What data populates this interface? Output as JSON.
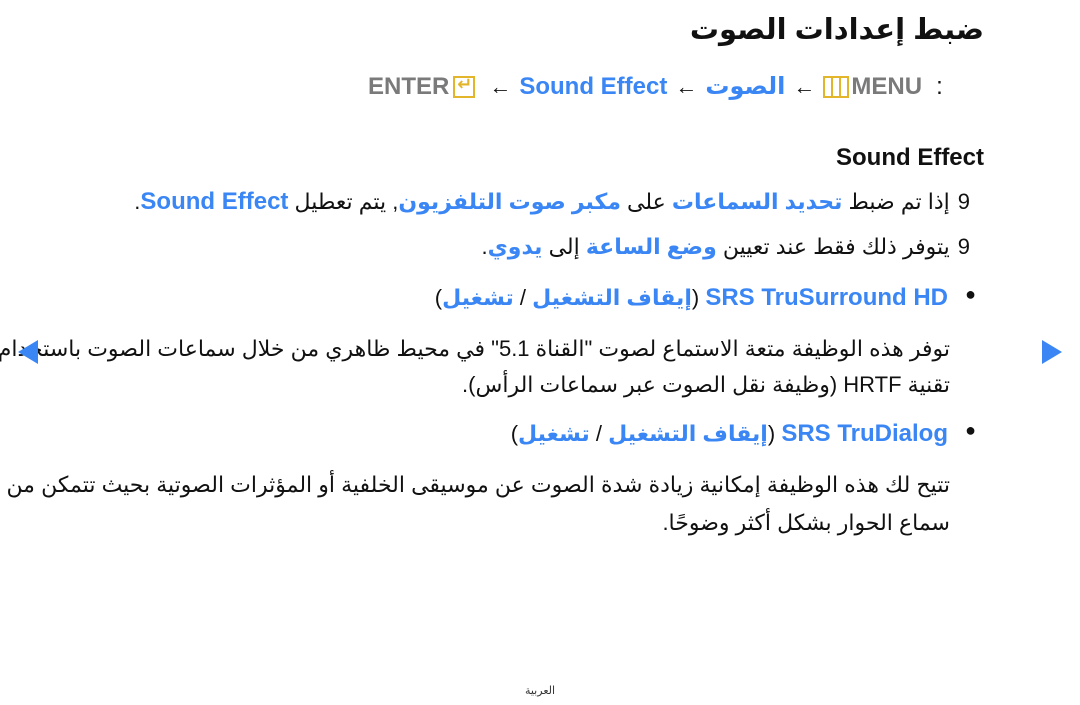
{
  "page": {
    "title": "ضبط إعدادات الصوت",
    "menu_path": {
      "enter_label": "ENTER",
      "enter_icon": "enter-icon",
      "arrow": "←",
      "sound_effect": "Sound Effect",
      "sound": "الصوت",
      "menu_icon": "menu-icon",
      "menu_label": "MENU",
      "colon": ":"
    },
    "section_heading": "Sound Effect",
    "notes": [
      {
        "marker": "9",
        "parts": [
          {
            "text": "إذا تم ضبط ",
            "style": "normal"
          },
          {
            "text": "تحديد السماعات",
            "style": "blue"
          },
          {
            "text": " على ",
            "style": "normal"
          },
          {
            "text": "مكبر صوت التلفزيون",
            "style": "blue"
          },
          {
            "text": ", يتم تعطيل ",
            "style": "normal"
          },
          {
            "text": "Sound Effect",
            "style": "bluebig"
          },
          {
            "text": ".",
            "style": "normal"
          }
        ]
      },
      {
        "marker": "9",
        "parts": [
          {
            "text": "يتوفر ذلك فقط عند تعيين ",
            "style": "normal"
          },
          {
            "text": "وضع الساعة",
            "style": "blue"
          },
          {
            "text": " إلى ",
            "style": "normal"
          },
          {
            "text": "يدوي",
            "style": "blue"
          },
          {
            "text": ".",
            "style": "normal"
          }
        ]
      }
    ],
    "options": [
      {
        "name": "SRS TruSurround HD",
        "values": "(إيقاف التشغيل / تشغيل)",
        "off": "إيقاف التشغيل",
        "on": "تشغيل",
        "description_lines": [
          "توفر هذه الوظيفة متعة الاستماع لصوت \"القناة 5.1\" في محيط ظاهري من خلال سماعات الصوت باستخدام",
          "تقنية HRTF (وظيفة نقل الصوت عبر سماعات الرأس)."
        ]
      },
      {
        "name": "SRS TruDialog",
        "values": "(إيقاف التشغيل / تشغيل)",
        "off": "إيقاف التشغيل",
        "on": "تشغيل",
        "description_lines": [
          "تتيح لك هذه الوظيفة إمكانية زيادة شدة الصوت عن موسيقى الخلفية أو المؤثرات الصوتية بحيث تتمكن من",
          "سماع الحوار بشكل أكثر وضوحًا."
        ]
      }
    ],
    "nav": {
      "prev_icon": "triangle-left-icon",
      "next_icon": "triangle-right-icon"
    },
    "footer": "العربية",
    "colors": {
      "accent_blue": "#3a86f4",
      "icon_yellow": "#e2b52a",
      "menu_gray": "#7a7a7a"
    }
  }
}
